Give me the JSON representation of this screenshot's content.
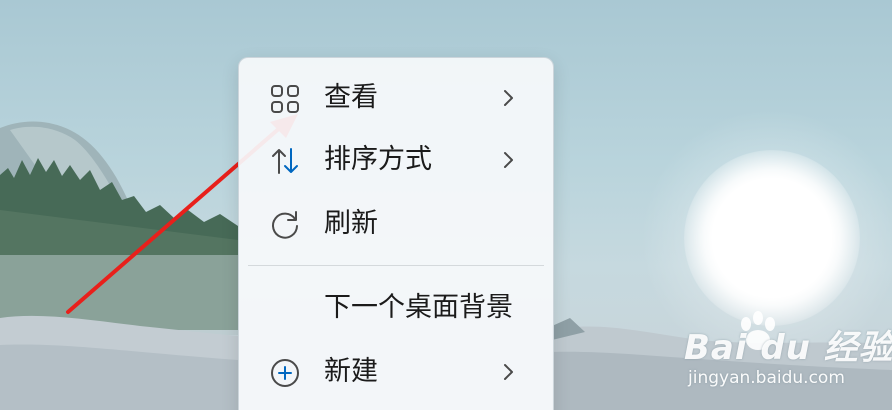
{
  "context_menu": {
    "items": [
      {
        "label": "查看",
        "icon": "grid-view-icon",
        "has_submenu": true
      },
      {
        "label": "排序方式",
        "icon": "sort-arrows-icon",
        "has_submenu": true
      },
      {
        "label": "刷新",
        "icon": "refresh-icon",
        "has_submenu": false
      },
      {
        "label": "下一个桌面背景",
        "icon": "",
        "has_submenu": false
      },
      {
        "label": "新建",
        "icon": "add-circle-icon",
        "has_submenu": true
      }
    ]
  },
  "watermark": {
    "brand": "Bai du 经验",
    "url": "jingyan.baidu.com"
  },
  "colors": {
    "accent": "#0067c0",
    "annotation_arrow": "#e8201b",
    "icon_gray": "#4a4a4a"
  }
}
